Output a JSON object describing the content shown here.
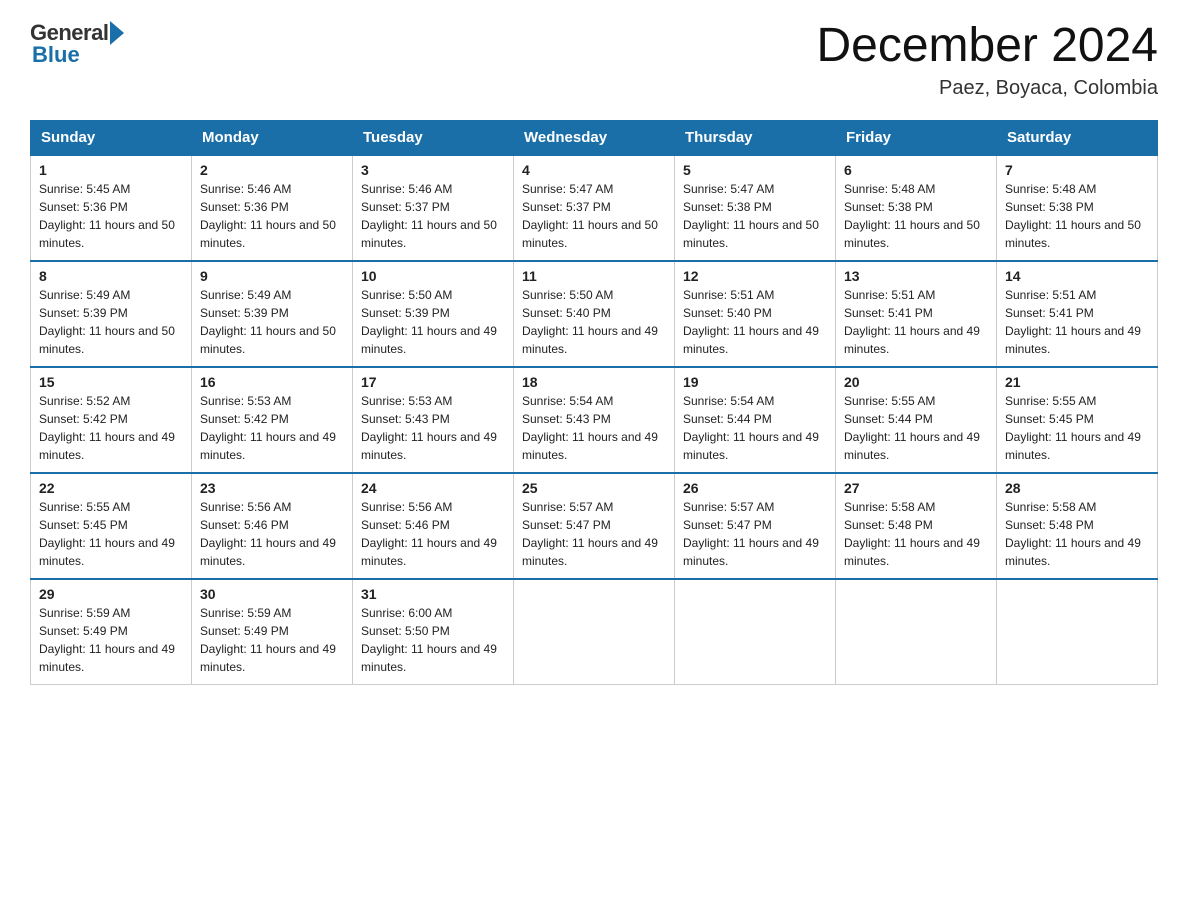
{
  "header": {
    "logo_general": "General",
    "logo_blue": "Blue",
    "title": "December 2024",
    "location": "Paez, Boyaca, Colombia"
  },
  "weekdays": [
    "Sunday",
    "Monday",
    "Tuesday",
    "Wednesday",
    "Thursday",
    "Friday",
    "Saturday"
  ],
  "weeks": [
    [
      {
        "day": "1",
        "sunrise": "5:45 AM",
        "sunset": "5:36 PM",
        "daylight": "11 hours and 50 minutes."
      },
      {
        "day": "2",
        "sunrise": "5:46 AM",
        "sunset": "5:36 PM",
        "daylight": "11 hours and 50 minutes."
      },
      {
        "day": "3",
        "sunrise": "5:46 AM",
        "sunset": "5:37 PM",
        "daylight": "11 hours and 50 minutes."
      },
      {
        "day": "4",
        "sunrise": "5:47 AM",
        "sunset": "5:37 PM",
        "daylight": "11 hours and 50 minutes."
      },
      {
        "day": "5",
        "sunrise": "5:47 AM",
        "sunset": "5:38 PM",
        "daylight": "11 hours and 50 minutes."
      },
      {
        "day": "6",
        "sunrise": "5:48 AM",
        "sunset": "5:38 PM",
        "daylight": "11 hours and 50 minutes."
      },
      {
        "day": "7",
        "sunrise": "5:48 AM",
        "sunset": "5:38 PM",
        "daylight": "11 hours and 50 minutes."
      }
    ],
    [
      {
        "day": "8",
        "sunrise": "5:49 AM",
        "sunset": "5:39 PM",
        "daylight": "11 hours and 50 minutes."
      },
      {
        "day": "9",
        "sunrise": "5:49 AM",
        "sunset": "5:39 PM",
        "daylight": "11 hours and 50 minutes."
      },
      {
        "day": "10",
        "sunrise": "5:50 AM",
        "sunset": "5:39 PM",
        "daylight": "11 hours and 49 minutes."
      },
      {
        "day": "11",
        "sunrise": "5:50 AM",
        "sunset": "5:40 PM",
        "daylight": "11 hours and 49 minutes."
      },
      {
        "day": "12",
        "sunrise": "5:51 AM",
        "sunset": "5:40 PM",
        "daylight": "11 hours and 49 minutes."
      },
      {
        "day": "13",
        "sunrise": "5:51 AM",
        "sunset": "5:41 PM",
        "daylight": "11 hours and 49 minutes."
      },
      {
        "day": "14",
        "sunrise": "5:51 AM",
        "sunset": "5:41 PM",
        "daylight": "11 hours and 49 minutes."
      }
    ],
    [
      {
        "day": "15",
        "sunrise": "5:52 AM",
        "sunset": "5:42 PM",
        "daylight": "11 hours and 49 minutes."
      },
      {
        "day": "16",
        "sunrise": "5:53 AM",
        "sunset": "5:42 PM",
        "daylight": "11 hours and 49 minutes."
      },
      {
        "day": "17",
        "sunrise": "5:53 AM",
        "sunset": "5:43 PM",
        "daylight": "11 hours and 49 minutes."
      },
      {
        "day": "18",
        "sunrise": "5:54 AM",
        "sunset": "5:43 PM",
        "daylight": "11 hours and 49 minutes."
      },
      {
        "day": "19",
        "sunrise": "5:54 AM",
        "sunset": "5:44 PM",
        "daylight": "11 hours and 49 minutes."
      },
      {
        "day": "20",
        "sunrise": "5:55 AM",
        "sunset": "5:44 PM",
        "daylight": "11 hours and 49 minutes."
      },
      {
        "day": "21",
        "sunrise": "5:55 AM",
        "sunset": "5:45 PM",
        "daylight": "11 hours and 49 minutes."
      }
    ],
    [
      {
        "day": "22",
        "sunrise": "5:55 AM",
        "sunset": "5:45 PM",
        "daylight": "11 hours and 49 minutes."
      },
      {
        "day": "23",
        "sunrise": "5:56 AM",
        "sunset": "5:46 PM",
        "daylight": "11 hours and 49 minutes."
      },
      {
        "day": "24",
        "sunrise": "5:56 AM",
        "sunset": "5:46 PM",
        "daylight": "11 hours and 49 minutes."
      },
      {
        "day": "25",
        "sunrise": "5:57 AM",
        "sunset": "5:47 PM",
        "daylight": "11 hours and 49 minutes."
      },
      {
        "day": "26",
        "sunrise": "5:57 AM",
        "sunset": "5:47 PM",
        "daylight": "11 hours and 49 minutes."
      },
      {
        "day": "27",
        "sunrise": "5:58 AM",
        "sunset": "5:48 PM",
        "daylight": "11 hours and 49 minutes."
      },
      {
        "day": "28",
        "sunrise": "5:58 AM",
        "sunset": "5:48 PM",
        "daylight": "11 hours and 49 minutes."
      }
    ],
    [
      {
        "day": "29",
        "sunrise": "5:59 AM",
        "sunset": "5:49 PM",
        "daylight": "11 hours and 49 minutes."
      },
      {
        "day": "30",
        "sunrise": "5:59 AM",
        "sunset": "5:49 PM",
        "daylight": "11 hours and 49 minutes."
      },
      {
        "day": "31",
        "sunrise": "6:00 AM",
        "sunset": "5:50 PM",
        "daylight": "11 hours and 49 minutes."
      },
      null,
      null,
      null,
      null
    ]
  ],
  "labels": {
    "sunrise_prefix": "Sunrise: ",
    "sunset_prefix": "Sunset: ",
    "daylight_prefix": "Daylight: "
  }
}
